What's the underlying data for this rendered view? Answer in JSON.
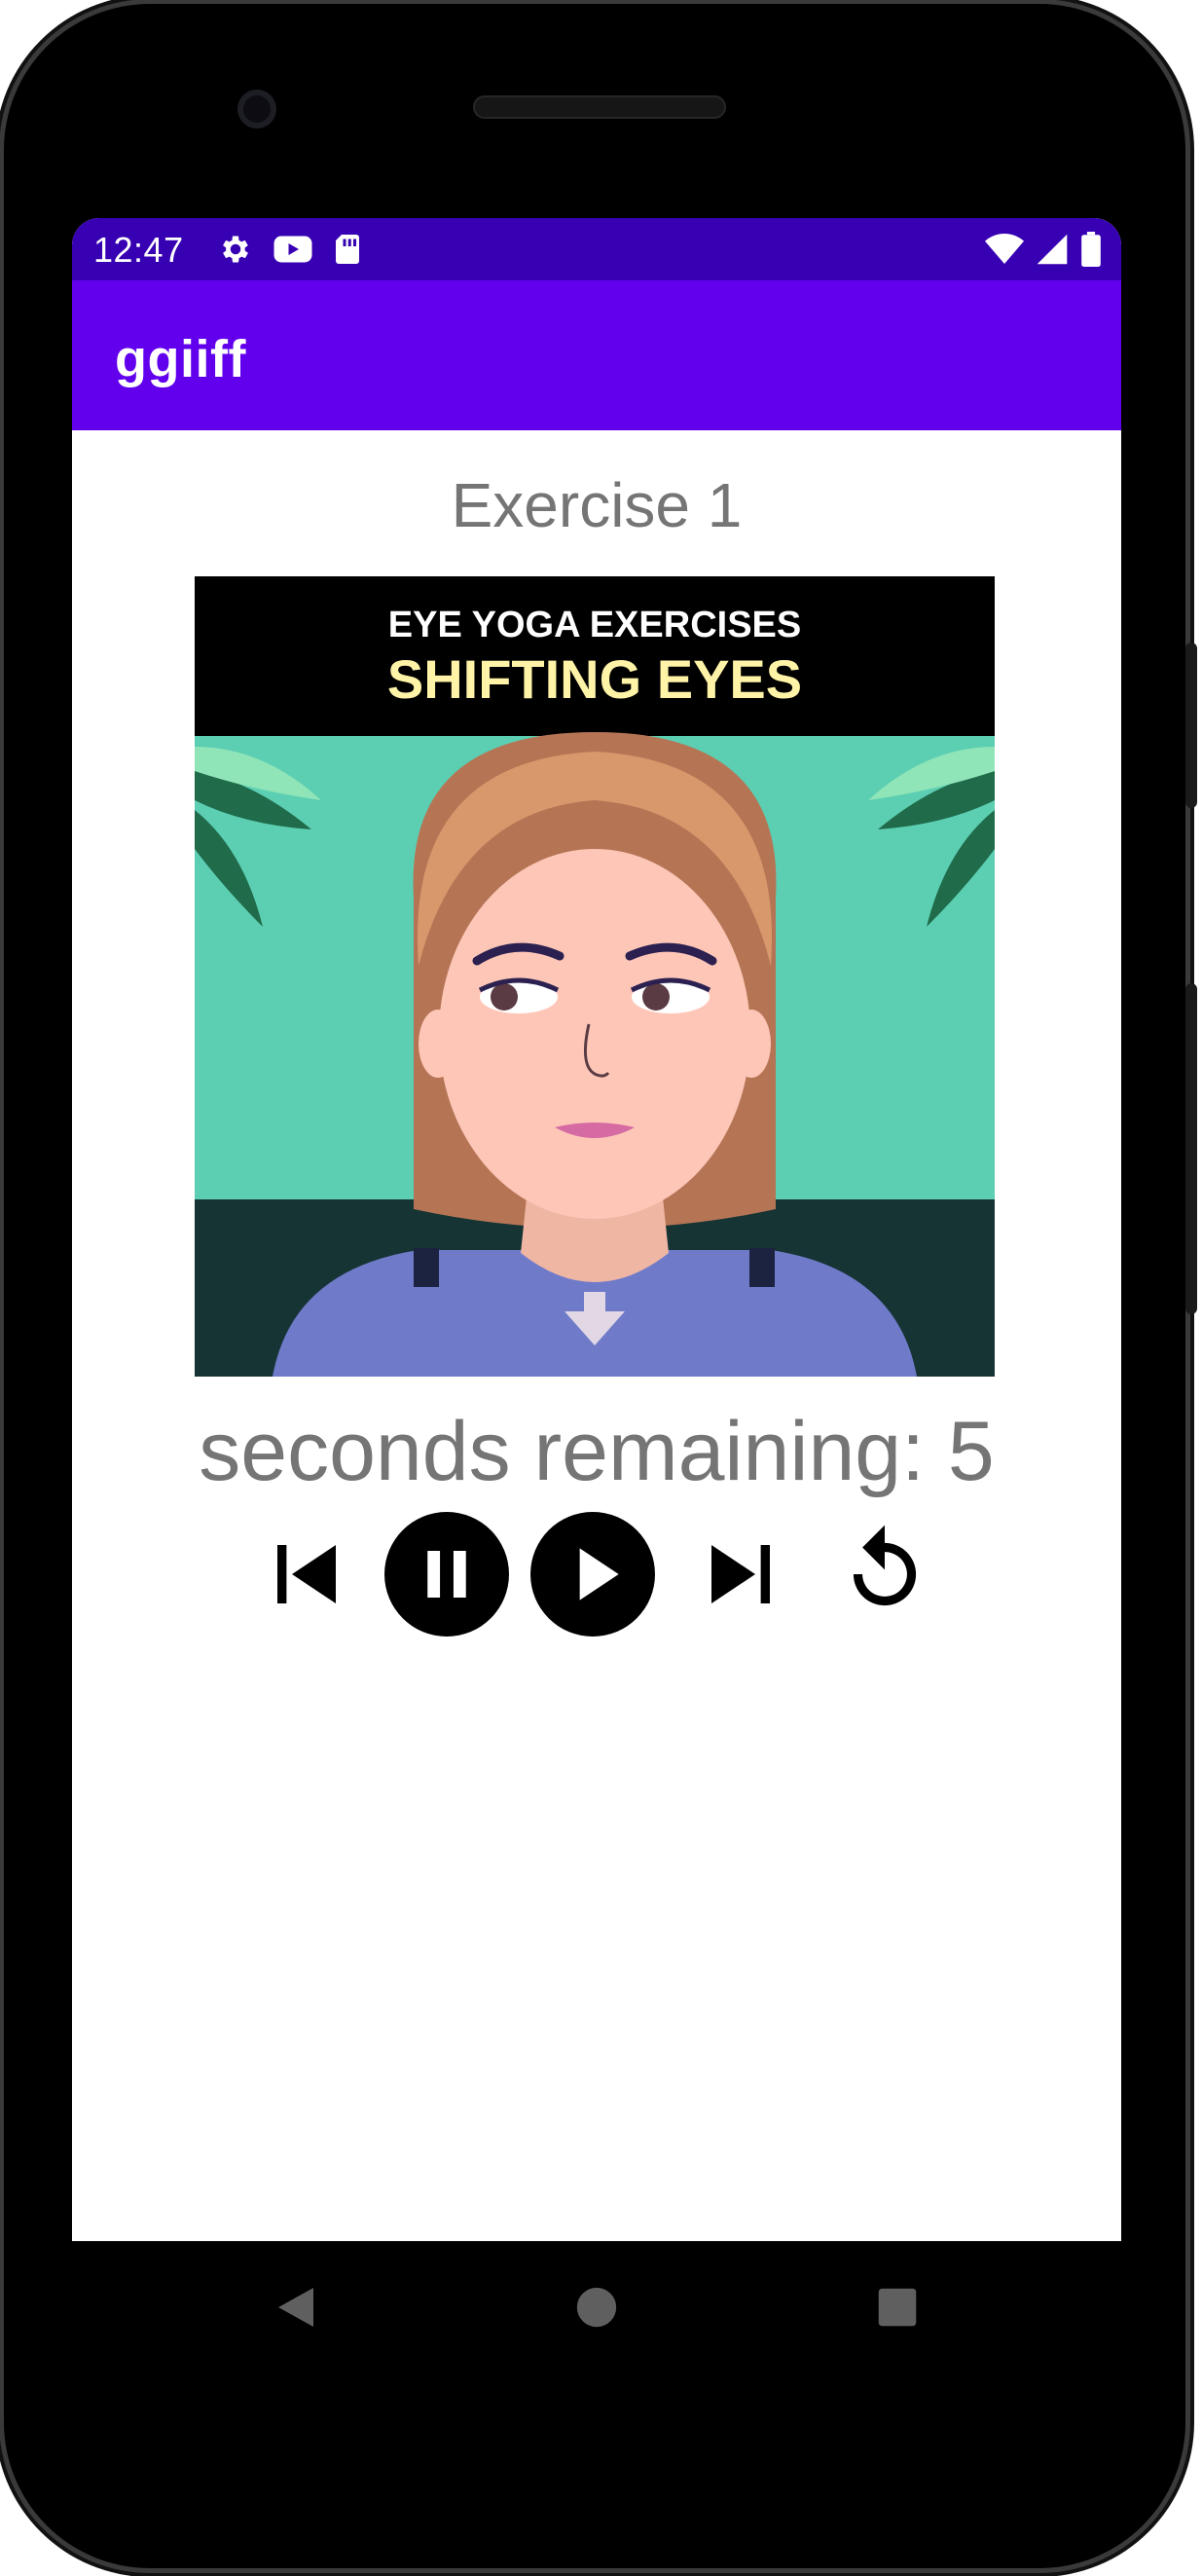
{
  "status_bar": {
    "time": "12:47",
    "left_icons": [
      "settings-icon",
      "youtube-icon",
      "sd-card-icon"
    ],
    "right_icons": [
      "wifi-icon",
      "cell-signal-icon",
      "battery-icon"
    ]
  },
  "app_bar": {
    "title": "ggiiff"
  },
  "exercise": {
    "title": "Exercise 1"
  },
  "gif": {
    "caption_line1": "EYE YOGA EXERCISES",
    "caption_line2": "SHIFTING EYES"
  },
  "timer": {
    "text": "seconds remaining: 5"
  },
  "controls": [
    "skip-previous-icon",
    "pause-icon",
    "play-icon",
    "skip-next-icon",
    "replay-icon"
  ],
  "navigation": [
    "back-icon",
    "home-icon",
    "recents-icon"
  ],
  "colors": {
    "status_bar": "#3700b3",
    "app_bar": "#6200ee",
    "text_gray": "#757575"
  }
}
